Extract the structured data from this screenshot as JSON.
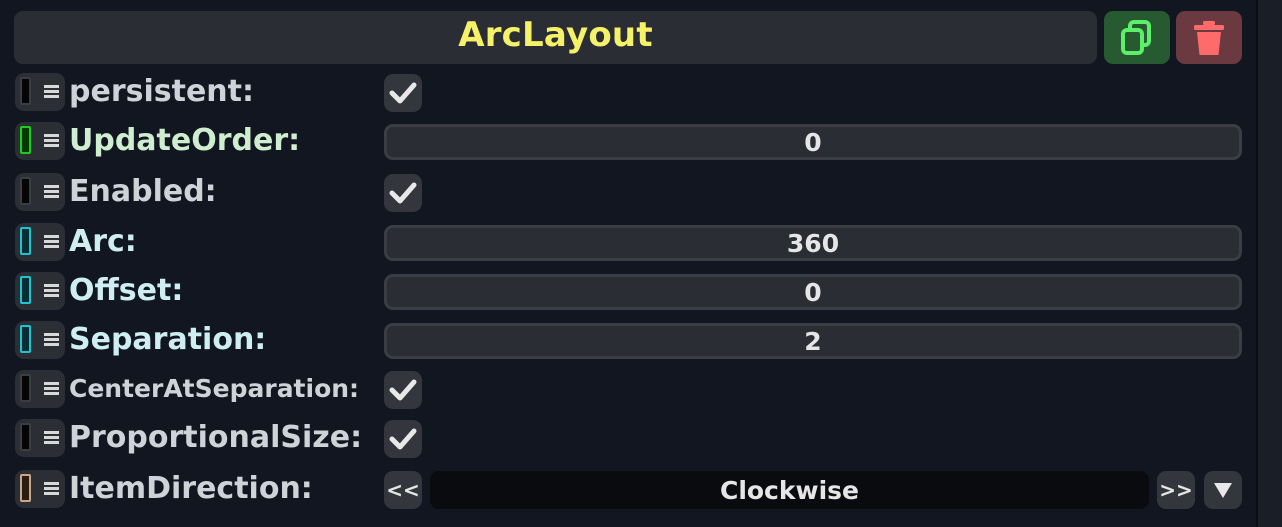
{
  "component": {
    "title": "ArcLayout",
    "duplicate_icon": "copy-icon",
    "delete_icon": "trash-icon",
    "title_color": "#f5f26a"
  },
  "fields": {
    "persistent": {
      "label": "persistent:",
      "checked": true,
      "swatch_color": "#050505"
    },
    "update_order": {
      "label": "UpdateOrder:",
      "value": "0",
      "swatch_color": "#0c6d0c",
      "label_color": "#cfeecf"
    },
    "enabled": {
      "label": "Enabled:",
      "checked": true,
      "swatch_color": "#050505"
    },
    "arc": {
      "label": "Arc:",
      "value": "360",
      "swatch_color": "#1ac6d4",
      "label_color": "#cfeef2"
    },
    "offset": {
      "label": "Offset:",
      "value": "0",
      "swatch_color": "#1ac6d4",
      "label_color": "#cfeef2"
    },
    "separation": {
      "label": "Separation:",
      "value": "2",
      "swatch_color": "#1ac6d4",
      "label_color": "#cfeef2"
    },
    "center_at_separation": {
      "label": "CenterAtSeparation:",
      "checked": true,
      "swatch_color": "#050505"
    },
    "proportional_size": {
      "label": "ProportionalSize:",
      "checked": true,
      "swatch_color": "#050505"
    },
    "item_direction": {
      "label": "ItemDirection:",
      "value": "Clockwise",
      "prev_label": "<<",
      "next_label": ">>",
      "dropdown_icon": "triangle-down-icon",
      "swatch_color": "#c9a88a"
    }
  }
}
